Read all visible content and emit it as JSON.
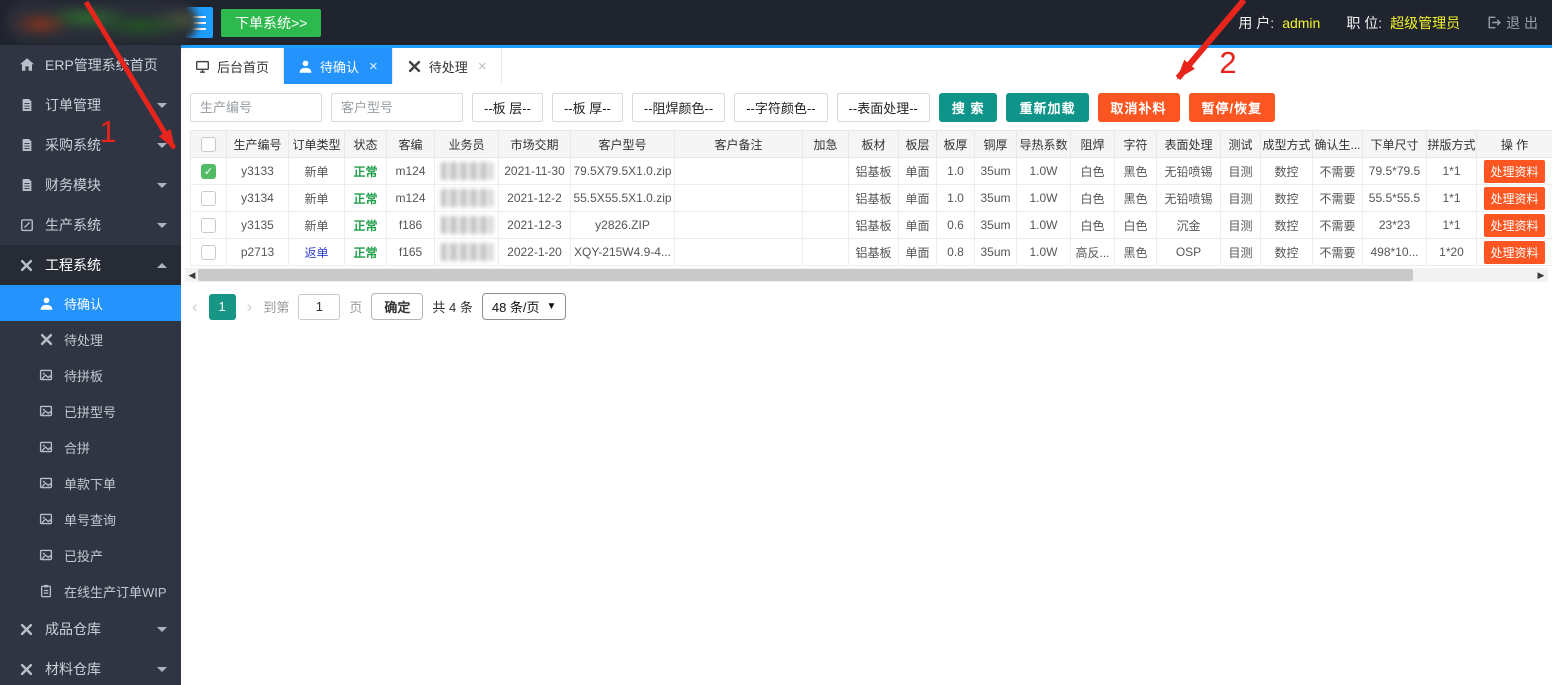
{
  "topbar": {
    "order_system_label": "下单系统>>",
    "user_label": "用 户:",
    "user_value": "admin",
    "role_label": "职 位:",
    "role_value": "超级管理员",
    "logout_label": "退 出"
  },
  "colors": {
    "accent_blue": "#2593fc",
    "strip_blue": "#1E9FFF",
    "teal_button": "#0e9488",
    "orange_button": "#fb5622",
    "green_button": "#2DB94D",
    "status_green": "#21a04a",
    "return_order_blue": "#3341d4",
    "annotation_red": "#e8251c",
    "sidebar_bg": "#2f3543",
    "topbar_bg": "#20242e"
  },
  "sidebar": {
    "main_items": [
      {
        "label": "ERP管理系统首页",
        "icon": "home",
        "caret": ""
      },
      {
        "label": "订单管理",
        "icon": "file",
        "caret": "down"
      },
      {
        "label": "采购系统",
        "icon": "file",
        "caret": "down"
      },
      {
        "label": "财务模块",
        "icon": "file",
        "caret": "down"
      },
      {
        "label": "生产系统",
        "icon": "edit",
        "caret": "down"
      },
      {
        "label": "工程系统",
        "icon": "wrench",
        "caret": "up",
        "open": true
      }
    ],
    "submenu": [
      {
        "label": "待确认",
        "icon": "user",
        "active": true
      },
      {
        "label": "待处理",
        "icon": "wrench",
        "active": false
      },
      {
        "label": "待拼板",
        "icon": "image",
        "active": false
      },
      {
        "label": "已拼型号",
        "icon": "image",
        "active": false
      },
      {
        "label": "合拼",
        "icon": "image",
        "active": false
      },
      {
        "label": "单款下单",
        "icon": "image",
        "active": false
      },
      {
        "label": "单号查询",
        "icon": "image",
        "active": false
      },
      {
        "label": "已投产",
        "icon": "image",
        "active": false
      },
      {
        "label": "在线生产订单WIP",
        "icon": "clipboard",
        "active": false
      }
    ],
    "bottom_items": [
      {
        "label": "成品仓库",
        "icon": "wrench",
        "caret": "down"
      },
      {
        "label": "材料仓库",
        "icon": "wrench",
        "caret": "down"
      }
    ]
  },
  "tabs": [
    {
      "label": "后台首页",
      "icon": "desktop",
      "closable": false,
      "active": false
    },
    {
      "label": "待确认",
      "icon": "user",
      "closable": true,
      "active": true
    },
    {
      "label": "待处理",
      "icon": "wrench",
      "closable": true,
      "active": false
    }
  ],
  "filters": {
    "inputs": [
      {
        "placeholder": "生产编号",
        "value": ""
      },
      {
        "placeholder": "客户型号",
        "value": ""
      }
    ],
    "dropdowns": [
      "--板 层--",
      "--板 厚--",
      "--阻焊颜色--",
      "--字符颜色--",
      "--表面处理--"
    ],
    "buttons": [
      {
        "label": "搜 索",
        "style": "teal"
      },
      {
        "label": "重新加载",
        "style": "teal"
      },
      {
        "label": "取消补料",
        "style": "orange"
      },
      {
        "label": "暂停/恢复",
        "style": "orange"
      }
    ]
  },
  "table": {
    "columns": [
      "生产编号",
      "订单类型",
      "状态",
      "客编",
      "业务员",
      "市场交期",
      "客户型号",
      "客户备注",
      "加急",
      "板材",
      "板层",
      "板厚",
      "铜厚",
      "导热系数",
      "阻焊",
      "字符",
      "表面处理",
      "测试",
      "成型方式",
      "确认生...",
      "下单尺寸",
      "拼版方式",
      "操 作"
    ],
    "action_label": "处理资料",
    "rows": [
      {
        "checked": true,
        "cells": [
          "y3133",
          "新单",
          "正常",
          "m124",
          "",
          "2021-11-30",
          "79.5X79.5X1.0.zip",
          "",
          "",
          "铝基板",
          "单面",
          "1.0",
          "35um",
          "1.0W",
          "白色",
          "黑色",
          "无铅喷锡",
          "目测",
          "数控",
          "不需要",
          "79.5*79.5",
          "1*1"
        ]
      },
      {
        "checked": false,
        "cells": [
          "y3134",
          "新单",
          "正常",
          "m124",
          "",
          "2021-12-2",
          "55.5X55.5X1.0.zip",
          "",
          "",
          "铝基板",
          "单面",
          "1.0",
          "35um",
          "1.0W",
          "白色",
          "黑色",
          "无铅喷锡",
          "目测",
          "数控",
          "不需要",
          "55.5*55.5",
          "1*1"
        ]
      },
      {
        "checked": false,
        "cells": [
          "y3135",
          "新单",
          "正常",
          "f186",
          "",
          "2021-12-3",
          "y2826.ZIP",
          "",
          "",
          "铝基板",
          "单面",
          "0.6",
          "35um",
          "1.0W",
          "白色",
          "白色",
          "沉金",
          "目测",
          "数控",
          "不需要",
          "23*23",
          "1*1"
        ]
      },
      {
        "checked": false,
        "cells": [
          "p2713",
          "返单",
          "正常",
          "f165",
          "",
          "2022-1-20",
          "XQY-215W4.9-4...",
          "",
          "",
          "铝基板",
          "单面",
          "0.8",
          "35um",
          "1.0W",
          "高反...",
          "黑色",
          "OSP",
          "目测",
          "数控",
          "不需要",
          "498*10...",
          "1*20"
        ]
      }
    ]
  },
  "pagination": {
    "current_page": "1",
    "goto_label": "到第",
    "page_input_value": "1",
    "page_unit": "页",
    "confirm_label": "确定",
    "total_label": "共 4 条",
    "page_size_label": "48 条/页"
  },
  "annotations": {
    "step1": "1",
    "step2": "2"
  }
}
